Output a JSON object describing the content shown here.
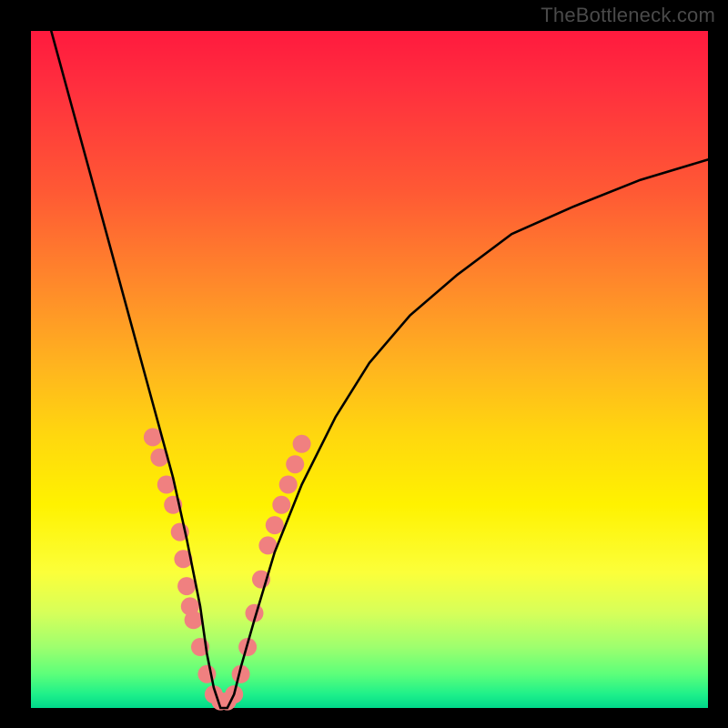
{
  "watermark": "TheBottleneck.com",
  "chart_data": {
    "type": "line",
    "title": "",
    "xlabel": "",
    "ylabel": "",
    "xlim": [
      0,
      100
    ],
    "ylim": [
      0,
      100
    ],
    "background_gradient": {
      "top": "#ff1a3e",
      "middle": "#fff200",
      "bottom": "#00d88a"
    },
    "curve": {
      "description": "V-shaped bottleneck curve; steep descent from top-left, minimum near x≈28, asymptotic rise toward right",
      "x": [
        3,
        6,
        9,
        12,
        15,
        18,
        21,
        23,
        25,
        26,
        27,
        28,
        29,
        30,
        31,
        33,
        36,
        40,
        45,
        50,
        56,
        63,
        71,
        80,
        90,
        100
      ],
      "y": [
        100,
        89,
        78,
        67,
        56,
        45,
        34,
        25,
        15,
        8,
        3,
        0,
        0,
        2,
        6,
        13,
        23,
        33,
        43,
        51,
        58,
        64,
        70,
        74,
        78,
        81
      ],
      "minimum_x": 28,
      "minimum_y": 0
    },
    "markers": {
      "color": "#f08080",
      "radius_px": 10,
      "points": [
        {
          "x": 18,
          "y": 40
        },
        {
          "x": 19,
          "y": 37
        },
        {
          "x": 20,
          "y": 33
        },
        {
          "x": 21,
          "y": 30
        },
        {
          "x": 22,
          "y": 26
        },
        {
          "x": 22.5,
          "y": 22
        },
        {
          "x": 23,
          "y": 18
        },
        {
          "x": 23.5,
          "y": 15
        },
        {
          "x": 24,
          "y": 13
        },
        {
          "x": 25,
          "y": 9
        },
        {
          "x": 26,
          "y": 5
        },
        {
          "x": 27,
          "y": 2
        },
        {
          "x": 28,
          "y": 1
        },
        {
          "x": 29,
          "y": 1
        },
        {
          "x": 30,
          "y": 2
        },
        {
          "x": 31,
          "y": 5
        },
        {
          "x": 32,
          "y": 9
        },
        {
          "x": 33,
          "y": 14
        },
        {
          "x": 34,
          "y": 19
        },
        {
          "x": 35,
          "y": 24
        },
        {
          "x": 36,
          "y": 27
        },
        {
          "x": 37,
          "y": 30
        },
        {
          "x": 38,
          "y": 33
        },
        {
          "x": 39,
          "y": 36
        },
        {
          "x": 40,
          "y": 39
        }
      ]
    }
  }
}
